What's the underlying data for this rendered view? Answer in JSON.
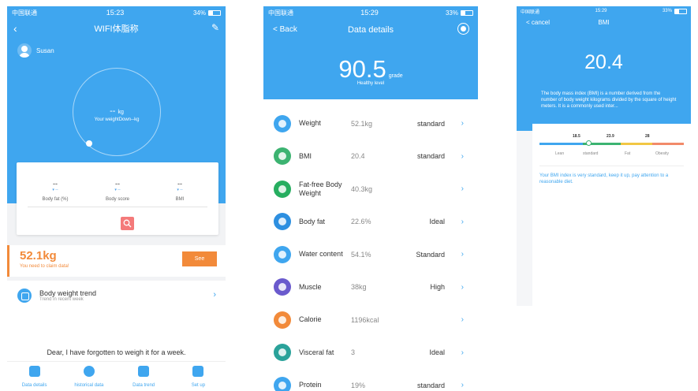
{
  "phone1": {
    "status": {
      "carrier": "中国联通",
      "time": "15:23",
      "battery": "34%",
      "battery_level": 0.34
    },
    "nav": {
      "title": "WIFI体脂称"
    },
    "user": {
      "name": "Susan"
    },
    "gauge": {
      "value": "--",
      "unit": "kg",
      "subtitle": "Your weightDown--kg"
    },
    "metrics": [
      {
        "value": "--",
        "arrow": "▾ --",
        "label": "Body fat (%)"
      },
      {
        "value": "--",
        "arrow": "▾ --",
        "label": "Body score"
      },
      {
        "value": "--",
        "arrow": "▾ --",
        "label": "BMI"
      }
    ],
    "weight": {
      "value": "52.1kg",
      "subtitle": "You need to claim data!",
      "button": "See"
    },
    "trend": {
      "title": "Body weight trend",
      "subtitle": "Trend in recent week"
    },
    "message": "Dear, I have forgotten to weigh it for a week.",
    "tabs": [
      {
        "label": "Data details",
        "icon": "document-icon"
      },
      {
        "label": "historical data",
        "icon": "clock-icon"
      },
      {
        "label": "Data trend",
        "icon": "bar-chart-icon"
      },
      {
        "label": "Set up",
        "icon": "settings-icon"
      }
    ],
    "colors": {
      "primary": "#3fa6ef",
      "accent": "#f28a3a",
      "search": "#f47a7a"
    }
  },
  "phone2": {
    "status": {
      "carrier": "中国联通",
      "time": "15:29",
      "battery": "33%",
      "battery_level": 0.33
    },
    "nav": {
      "back": "< Back",
      "title": "Data details"
    },
    "score": {
      "value": "90.5",
      "unit": "grade",
      "level": "Healthy level"
    },
    "rows": [
      {
        "name": "Weight",
        "value": "52.1kg",
        "status": "standard",
        "color": "#3fa6ef"
      },
      {
        "name": "BMI",
        "value": "20.4",
        "status": "standard",
        "color": "#3cb371"
      },
      {
        "name": "Fat-free Body Weight",
        "value": "40.3kg",
        "status": "",
        "color": "#27ae60"
      },
      {
        "name": "Body fat",
        "value": "22.6%",
        "status": "Ideal",
        "color": "#2d8fe0"
      },
      {
        "name": "Water content",
        "value": "54.1%",
        "status": "Standard",
        "color": "#3fa6ef"
      },
      {
        "name": "Muscle",
        "value": "38kg",
        "status": "High",
        "color": "#6a5acd"
      },
      {
        "name": "Calorie",
        "value": "1196kcal",
        "status": "",
        "color": "#f28a3a"
      },
      {
        "name": "Visceral fat",
        "value": "3",
        "status": "Ideal",
        "color": "#2aa29a"
      },
      {
        "name": "Protein",
        "value": "19%",
        "status": "standard",
        "color": "#3fa6ef"
      }
    ]
  },
  "phone3": {
    "status": {
      "carrier": "中国联通",
      "time": "15:29",
      "battery": "33%",
      "battery_level": 0.33
    },
    "nav": {
      "cancel": "< cancel",
      "title": "BMI"
    },
    "bmi": {
      "value": "20.4",
      "description": "The body mass index (BMI) is a number derived from the number of body weight kilograms divided by the square of height meters. It is a commonly used inter...",
      "note": "Your BMI index is very standard, keep it up, pay attention to a reasonable diet."
    },
    "scale": {
      "ticks": [
        "18.5",
        "23.9",
        "28"
      ],
      "zones": [
        "Lean",
        "standard",
        "Fat",
        "Obesity"
      ],
      "colors": [
        "#3fa6ef",
        "#3cb371",
        "#f2c744",
        "#f28a6a"
      ]
    }
  }
}
